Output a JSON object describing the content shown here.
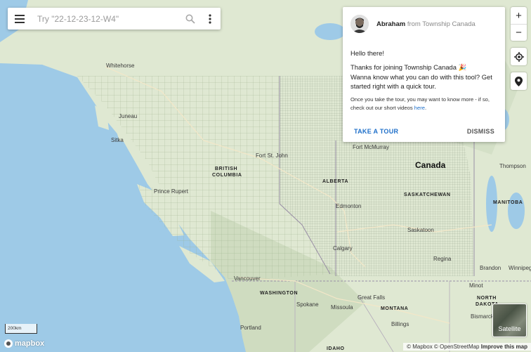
{
  "search": {
    "placeholder": "Try \"22-12-23-12-W4\"",
    "menu_icon": "hamburger-icon",
    "search_icon": "magnifier-icon",
    "more_icon": "kebab-icon"
  },
  "popup": {
    "name": "Abraham",
    "from": "from Township Canada",
    "greeting": "Hello there!",
    "body_line1": "Thanks for joining Township Canada 🎉",
    "body_line2": "Wanna know what you can do with this tool? Get started right with a quick tour.",
    "small_text": "Once you take the tour, you may want to know more - if so, check out our short videos",
    "small_link": "here",
    "take_tour": "TAKE A TOUR",
    "dismiss": "DISMISS"
  },
  "controls": {
    "zoom_in": "+",
    "zoom_out": "−"
  },
  "map": {
    "labels": {
      "whitehorse": "Whitehorse",
      "juneau": "Juneau",
      "sitka": "Sitka",
      "prince_rupert": "Prince Rupert",
      "british_columbia_1": "BRITISH",
      "british_columbia_2": "COLUMBIA",
      "fort_st_john": "Fort St. John",
      "fort_mcmurray": "Fort McMurray",
      "canada": "Canada",
      "alberta": "ALBERTA",
      "saskatchewan": "SASKATCHEWAN",
      "edmonton": "Edmonton",
      "saskatoon": "Saskatoon",
      "calgary": "Calgary",
      "regina": "Regina",
      "vancouver": "Vancouver",
      "washington": "WASHINGTON",
      "spokane": "Spokane",
      "great_falls": "Great Falls",
      "missoula": "Missoula",
      "montana": "MONTANA",
      "billings": "Billings",
      "portland": "Portland",
      "idaho": "IDAHO",
      "manitoba": "MANITOBA",
      "winnipeg": "Winnipeg",
      "brandon": "Brandon",
      "minot": "Minot",
      "north_dakota_1": "NORTH",
      "north_dakota_2": "DAKOTA",
      "bismarck": "Bismarck",
      "thompson": "Thompson"
    },
    "scale": "200km",
    "logo": "mapbox",
    "attribution": "© Mapbox © OpenStreetMap",
    "improve": "Improve this map",
    "satellite_label": "Satellite"
  },
  "colors": {
    "land": "#dfe8d2",
    "water": "#9ecae7",
    "link": "#1e6fc9"
  }
}
